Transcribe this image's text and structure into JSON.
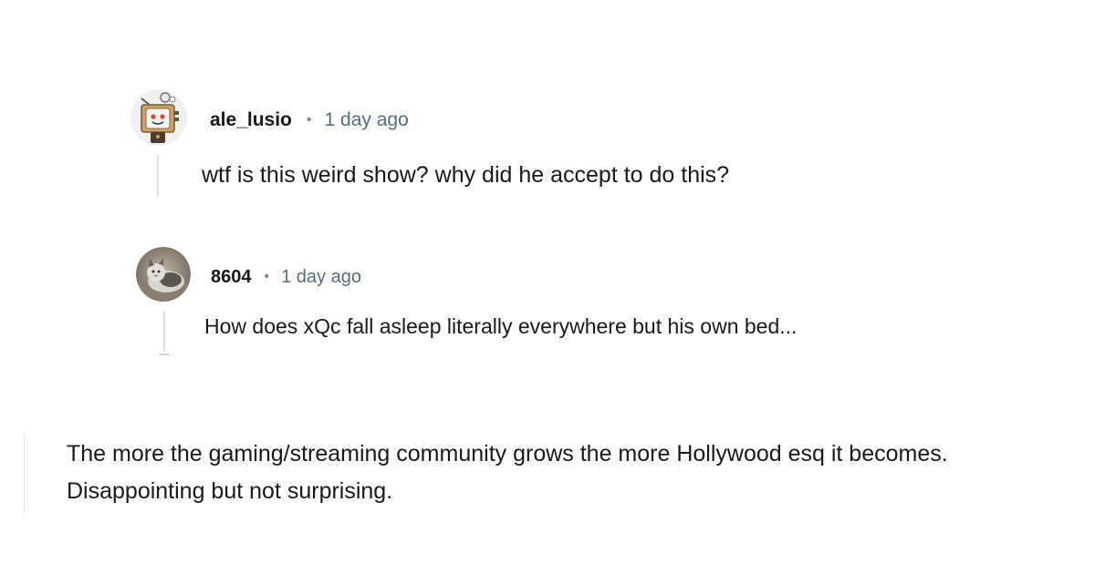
{
  "thread": {
    "comments": [
      {
        "username": "ale_lusio",
        "separator": "•",
        "time": "1 day ago",
        "text": "wtf is this weird show? why did he accept to do this?",
        "avatar_icon": "robot-tv-avatar-icon"
      },
      {
        "username": "8604",
        "separator": "•",
        "time": "1 day ago",
        "text": "How does xQc fall asleep literally everywhere but his own bed...",
        "avatar_icon": "cat-photo-avatar"
      }
    ]
  },
  "quote": {
    "lines": [
      "The more the gaming/streaming community grows the more Hollywood esq it becomes.",
      "Disappointing but not surprising."
    ]
  },
  "colors": {
    "username": "#1a1a1b",
    "timestamp": "#576f76",
    "thread_line": "#e0e3e5",
    "background": "#ffffff"
  }
}
